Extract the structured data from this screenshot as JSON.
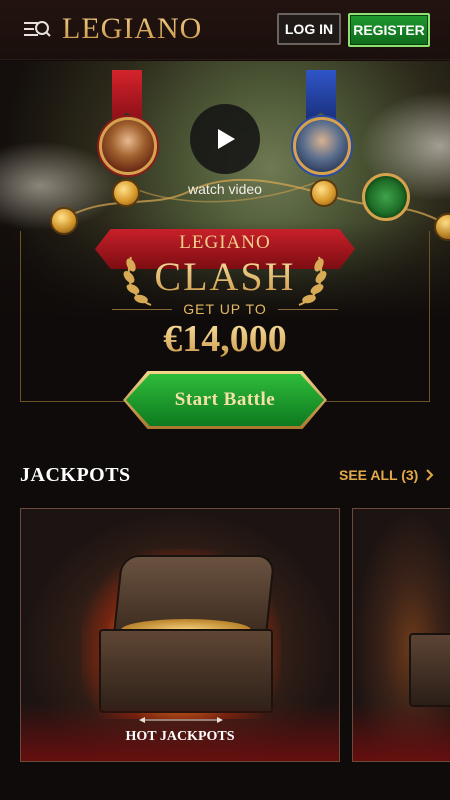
{
  "header": {
    "logo_text": "LegianO",
    "login_label": "LOG IN",
    "register_label": "REGISTER",
    "menu_icon": "search-menu-icon"
  },
  "hero": {
    "watch_video_label": "watch video",
    "brand_small": "LegianO",
    "title": "Clash",
    "subtitle": "GET UP TO",
    "prize": "€14,000",
    "cta_label": "Start Battle"
  },
  "jackpots": {
    "title": "Jackpots",
    "see_all_label": "SEE ALL (3)",
    "cards": [
      {
        "label": "HOT JACKPOTS"
      }
    ]
  },
  "colors": {
    "background": "#0f0b0a",
    "gold": "#e3a948",
    "register_green": "#1f9a2e"
  }
}
